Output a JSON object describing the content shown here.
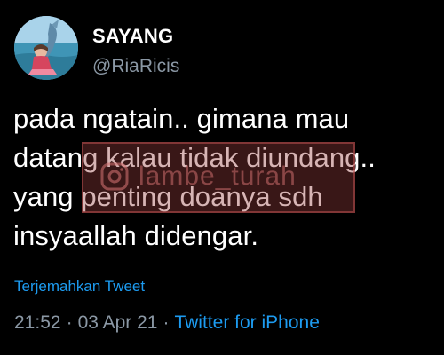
{
  "author": {
    "display_name": "SAYANG",
    "handle": "@RiaRicis",
    "avatar_icon": "profile-photo"
  },
  "tweet": {
    "text": "pada ngatain.. gimana mau\ndatang kalau tidak diundang..\nyang penting doanya sdh\ninsyaallah didengar.",
    "translate_label": "Terjemahkan Tweet",
    "time": "21:52",
    "separator": "·",
    "date": "03 Apr 21",
    "source": "Twitter for iPhone"
  },
  "watermark": {
    "text": "lambe_turah",
    "icon": "instagram-icon"
  },
  "colors": {
    "background": "#000000",
    "text": "#ffffff",
    "secondary": "#8b98a5",
    "link": "#1d9bf0"
  }
}
